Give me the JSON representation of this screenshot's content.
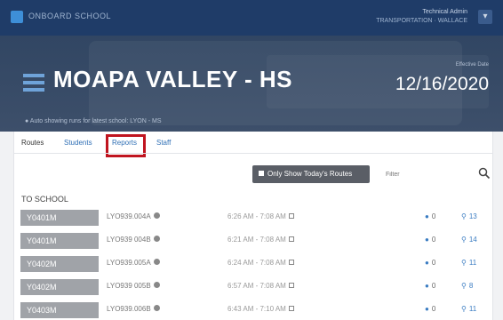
{
  "topbar": {
    "brand": "ONBOARD SCHOOL",
    "user_line1": "Technical Admin",
    "user_line2": "TRANSPORTATION · WALLACE",
    "user_icon": "user-icon"
  },
  "hero": {
    "school_name": "MOAPA VALLEY - HS",
    "subtitle": "Auto showing runs for latest school: LYON - MS",
    "date_label": "Effective Date",
    "date": "12/16/2020"
  },
  "tabs": [
    "Routes",
    "Students",
    "Reports",
    "Staff"
  ],
  "toolbar": {
    "toggle_label": "Only Show Today's Routes",
    "filter_placeholder": "Filter"
  },
  "section_label": "TO SCHOOL",
  "rows": [
    {
      "route": "Y0401M",
      "id": "LYO939.004A",
      "time": "6:26 AM - 7:08 AM",
      "riders": "0",
      "stops": "13"
    },
    {
      "route": "Y0401M",
      "id": "LYO939 004B",
      "time": "6:21 AM - 7:08 AM",
      "riders": "0",
      "stops": "14"
    },
    {
      "route": "Y0402M",
      "id": "LYO939.005A",
      "time": "6:24 AM - 7:08 AM",
      "riders": "0",
      "stops": "11"
    },
    {
      "route": "Y0402M",
      "id": "LYO939 005B",
      "time": "6:57 AM - 7:08 AM",
      "riders": "0",
      "stops": "8"
    },
    {
      "route": "Y0403M",
      "id": "LYO939.006B",
      "time": "6:43 AM - 7:10 AM",
      "riders": "0",
      "stops": "11"
    }
  ],
  "colors": {
    "topbar": "#1f3c68",
    "accent": "#2f6fb5",
    "highlight": "#c0141f",
    "route_pill": "#a0a3a8"
  }
}
